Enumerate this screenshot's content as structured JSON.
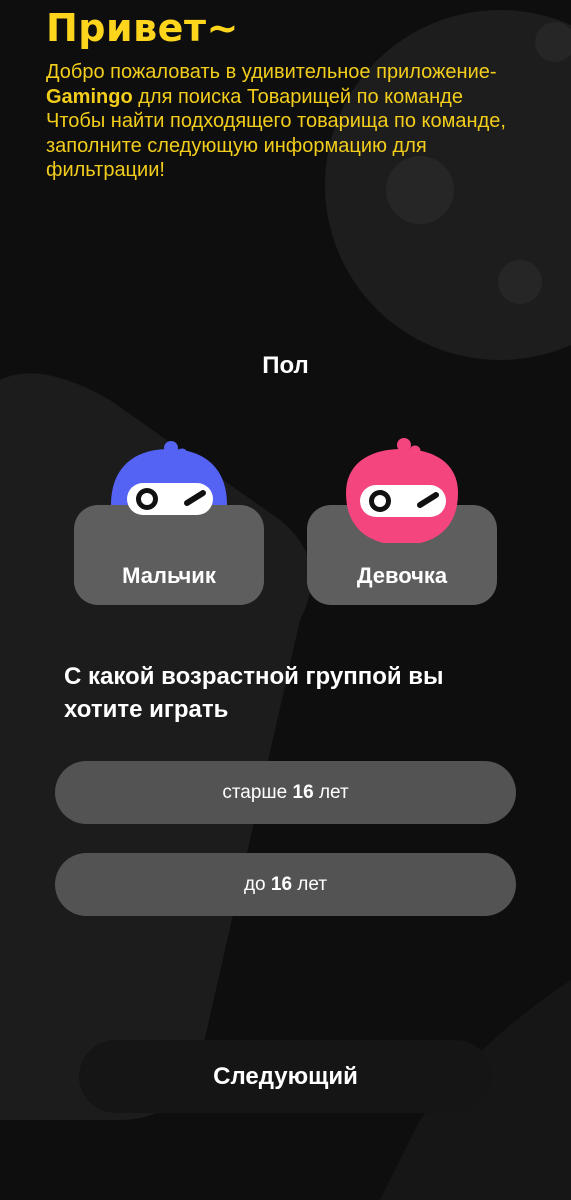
{
  "colors": {
    "accent": "#fdd51c",
    "boy_mascot": "#5563f5",
    "girl_mascot": "#f5457f",
    "card": "#5e5e5e",
    "option": "#535353"
  },
  "header": {
    "title": "Привет~",
    "intro_prefix": "Добро пожаловать в удивительное приложение-",
    "brand": "Gamingo",
    "intro_suffix": " для поиска Товарищей по команде",
    "intro_line2": "Чтобы найти подходящего товарища по команде, заполните следующую информацию для фильтрации!"
  },
  "gender": {
    "label": "Пол",
    "options": [
      {
        "label": "Мальчик",
        "icon": "boy-mascot-icon"
      },
      {
        "label": "Девочка",
        "icon": "girl-mascot-icon"
      }
    ]
  },
  "age": {
    "question": "С какой возрастной группой вы хотите играть",
    "options": [
      {
        "prefix": "старше ",
        "number": "16",
        "suffix": " лет"
      },
      {
        "prefix": "до ",
        "number": "16",
        "suffix": " лет"
      }
    ]
  },
  "footer": {
    "next_label": "Следующий"
  }
}
